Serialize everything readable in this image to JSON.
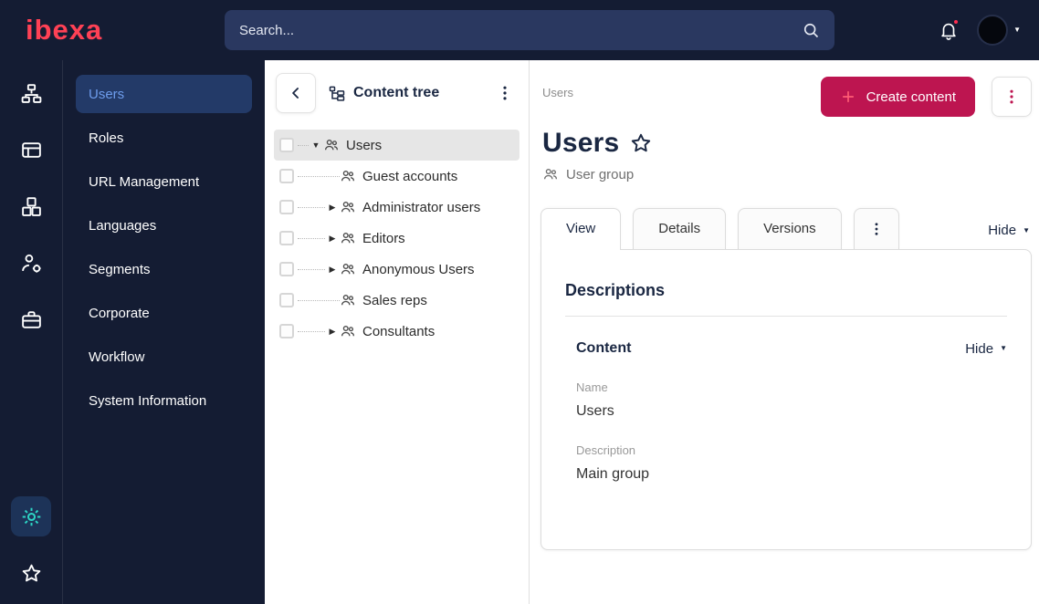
{
  "topbar": {
    "logo_text": "ibexa",
    "search_placeholder": "Search..."
  },
  "icon_rail": {
    "icons": [
      "sitemap-icon",
      "content-icon",
      "blocks-icon",
      "user-permissions-icon",
      "toolbox-icon",
      "settings-gear-icon",
      "bookmarks-star-icon"
    ],
    "active_icon": "settings-gear-icon"
  },
  "sidebar": {
    "items": [
      {
        "label": "Users",
        "active": true
      },
      {
        "label": "Roles",
        "active": false
      },
      {
        "label": "URL Management",
        "active": false
      },
      {
        "label": "Languages",
        "active": false
      },
      {
        "label": "Segments",
        "active": false
      },
      {
        "label": "Corporate",
        "active": false
      },
      {
        "label": "Workflow",
        "active": false
      },
      {
        "label": "System Information",
        "active": false
      }
    ]
  },
  "content_tree": {
    "title": "Content tree",
    "items": [
      {
        "label": "Users",
        "depth": 0,
        "caret": "expanded",
        "selected": true
      },
      {
        "label": "Guest accounts",
        "depth": 1,
        "caret": "none",
        "selected": false
      },
      {
        "label": "Administrator users",
        "depth": 1,
        "caret": "collapsed",
        "selected": false
      },
      {
        "label": "Editors",
        "depth": 1,
        "caret": "collapsed",
        "selected": false
      },
      {
        "label": "Anonymous Users",
        "depth": 1,
        "caret": "collapsed",
        "selected": false
      },
      {
        "label": "Sales reps",
        "depth": 1,
        "caret": "none",
        "selected": false
      },
      {
        "label": "Consultants",
        "depth": 1,
        "caret": "collapsed",
        "selected": false
      }
    ],
    "expanded_caret": "▼",
    "collapsed_caret": "▶"
  },
  "main": {
    "breadcrumb": "Users",
    "create_button_label": "Create content",
    "title": "Users",
    "content_type": "User group",
    "tabs": [
      {
        "label": "View",
        "active": true
      },
      {
        "label": "Details",
        "active": false
      },
      {
        "label": "Versions",
        "active": false
      }
    ],
    "hide_label": "Hide",
    "card": {
      "heading": "Descriptions",
      "section_heading": "Content",
      "section_hide_label": "Hide",
      "fields": [
        {
          "label": "Name",
          "value": "Users"
        },
        {
          "label": "Description",
          "value": "Main group"
        }
      ]
    }
  },
  "colors": {
    "topbar_bg": "#141c33",
    "accent": "#bd1550",
    "logo": "#ff4155",
    "active_menu_bg": "#233a68",
    "active_menu_text": "#6d9ceb",
    "gear_teal": "#2dd5c4",
    "tree_selected_bg": "#e6e6e6"
  }
}
